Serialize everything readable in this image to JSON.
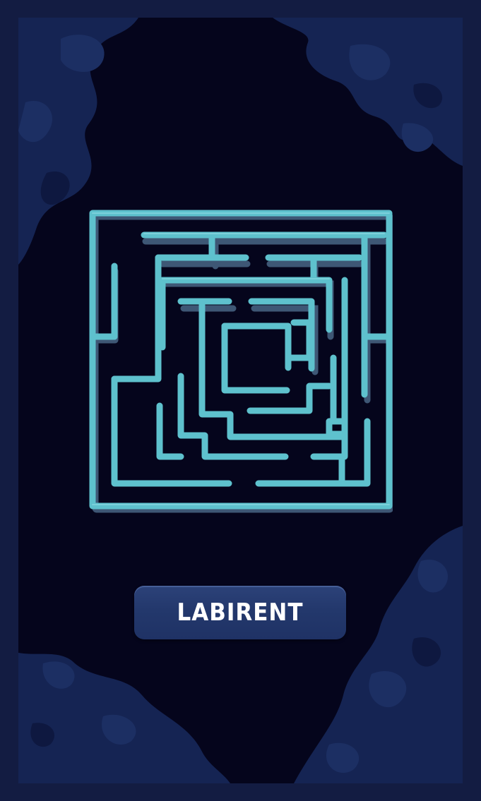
{
  "colors": {
    "frame": "#131c42",
    "background": "#05051c",
    "smoke": "#152453",
    "smoke_light": "#1c2f63",
    "maze_wall": "#5ec1cd",
    "maze_shadow": "#3e5775",
    "button": "#24386d",
    "button_text": "#ffffff"
  },
  "maze": {
    "icon": "square-maze-graphic"
  },
  "start_button": {
    "label": "LABIRENT"
  }
}
